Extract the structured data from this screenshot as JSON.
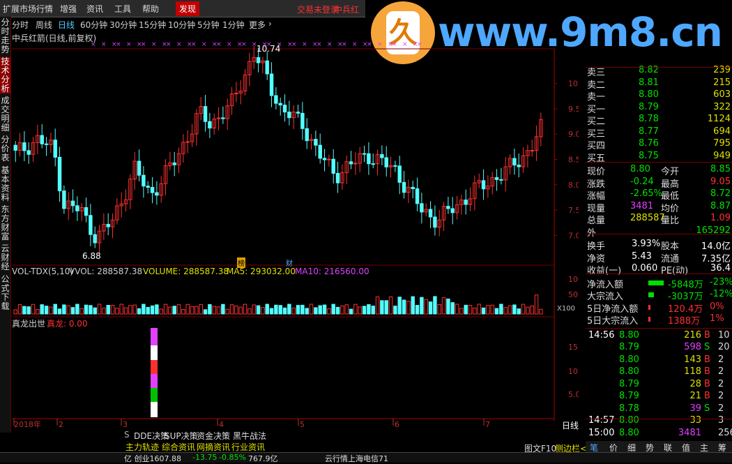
{
  "menu": {
    "items": [
      "扩展市场行情",
      "增强",
      "资讯",
      "工具",
      "帮助"
    ],
    "active": "发现",
    "alert1": "交易未登录",
    "alert2": "中兵红"
  },
  "left_tabs": [
    "分时走势",
    "技术分析",
    "成交明细",
    "分价表",
    "基本资料",
    "东方财富",
    "云财经",
    "公式下载"
  ],
  "periods": [
    "分时",
    "周线",
    "日线",
    "60分钟",
    "30分钟",
    "15分钟",
    "10分钟",
    "5分钟",
    "1分钟",
    "更多"
  ],
  "selected_period": "日线",
  "stock_title": "中兵红箭(日线,前复权)",
  "watermark": {
    "text": "www.9m8.cn",
    "logo_char": "久"
  },
  "price_axis": [
    "10.00",
    "9.50",
    "9.00",
    "8.50",
    "8.00",
    "7.50",
    "7.00"
  ],
  "high_label": "10.74",
  "low_label": "6.88",
  "badges": {
    "b1": "榜",
    "b2": "财"
  },
  "vol_panel": {
    "name": "VOL-TDX(5,10)",
    "vvol": "VVOL: 288587.38",
    "volume": "VOLUME: 288587.38",
    "ma5": "MA5: 293032.00",
    "ma10": "MA10: 216560.00",
    "axis": [
      "10000",
      "5000",
      "X100"
    ]
  },
  "ind_panel": {
    "name": "真龙出世",
    "value": "真龙: 0.00",
    "axis": [
      "15.00",
      "10.00",
      "5.00"
    ]
  },
  "dates": [
    "2018年",
    "2",
    "3",
    "4",
    "5",
    "6",
    "7"
  ],
  "period_label": "日线",
  "orderbook": [
    {
      "label": "卖三",
      "price": "8.82",
      "vol": "239",
      "color": "#00e000"
    },
    {
      "label": "卖二",
      "price": "8.81",
      "vol": "215",
      "color": "#00e000"
    },
    {
      "label": "卖一",
      "price": "8.80",
      "vol": "603",
      "color": "#00e000"
    },
    {
      "label": "买一",
      "price": "8.79",
      "vol": "322",
      "color": "#00e000"
    },
    {
      "label": "买二",
      "price": "8.78",
      "vol": "1124",
      "color": "#00e000"
    },
    {
      "label": "买三",
      "price": "8.77",
      "vol": "694",
      "color": "#00e000"
    },
    {
      "label": "买四",
      "price": "8.76",
      "vol": "795",
      "color": "#00e000"
    },
    {
      "label": "买五",
      "price": "8.75",
      "vol": "949",
      "color": "#00e000"
    }
  ],
  "quote": [
    {
      "l1": "现价",
      "v1": "8.80",
      "c1": "#00e000",
      "l2": "今开",
      "v2": "8.85",
      "c2": "#00e000"
    },
    {
      "l1": "涨跌",
      "v1": "-0.24",
      "c1": "#00e000",
      "l2": "最高",
      "v2": "9.05",
      "c2": "#ff3030"
    },
    {
      "l1": "涨幅",
      "v1": "-2.65%",
      "c1": "#00e000",
      "l2": "最低",
      "v2": "8.72",
      "c2": "#00e000"
    },
    {
      "l1": "现量",
      "v1": "3481",
      "c1": "#e040ff",
      "l2": "均价",
      "v2": "8.87",
      "c2": "#00e000"
    },
    {
      "l1": "总量",
      "v1": "288587",
      "c1": "#e0e000",
      "l2": "量比",
      "v2": "1.09",
      "c2": "#ff3030"
    },
    {
      "l1": "外",
      "v1": "",
      "c1": "#e0e000",
      "l2": "",
      "v2": "165292",
      "c2": "#00e000"
    }
  ],
  "fundamentals": [
    {
      "l1": "换手",
      "v1": "3.93%",
      "l2": "股本",
      "v2": "14.0亿"
    },
    {
      "l1": "净资",
      "v1": "5.43",
      "l2": "流通",
      "v2": "7.35亿"
    },
    {
      "l1": "收益(一)",
      "v1": "0.060",
      "l2": "PE(动)",
      "v2": "36.4"
    }
  ],
  "flows": [
    {
      "label": "净流入额",
      "value": "-5848万",
      "pct": "-23%",
      "color": "#00e000",
      "bar": 0.9,
      "barcolor": "#00e000"
    },
    {
      "label": "大宗流入",
      "value": "-3037万",
      "pct": "-12%",
      "color": "#00e000",
      "bar": 0.35,
      "barcolor": "#00e000"
    },
    {
      "label": "5日净流入额",
      "value": "120.4万",
      "pct": "0%",
      "color": "#ff3030",
      "bar": 0.1,
      "barcolor": "#ff3030"
    },
    {
      "label": "5日大宗流入",
      "value": "1388万",
      "pct": "1%",
      "color": "#ff3030",
      "bar": 0.1,
      "barcolor": "#ff3030"
    }
  ],
  "ticks": [
    {
      "time": "14:56",
      "price": "8.80",
      "vol": "216",
      "side": "B",
      "n": "10"
    },
    {
      "time": "",
      "price": "8.79",
      "vol": "598",
      "side": "S",
      "n": "20"
    },
    {
      "time": "",
      "price": "8.80",
      "vol": "143",
      "side": "B",
      "n": "2"
    },
    {
      "time": "",
      "price": "8.80",
      "vol": "118",
      "side": "B",
      "n": "2"
    },
    {
      "time": "",
      "price": "8.79",
      "vol": "28",
      "side": "B",
      "n": "2"
    },
    {
      "time": "",
      "price": "8.79",
      "vol": "21",
      "side": "B",
      "n": "2"
    },
    {
      "time": "",
      "price": "8.78",
      "vol": "39",
      "side": "S",
      "n": "2"
    },
    {
      "time": "14:57",
      "price": "8.80",
      "vol": "33",
      "side": "",
      "n": "3"
    },
    {
      "time": "15:00",
      "price": "8.80",
      "vol": "3481",
      "side": "",
      "n": "256"
    }
  ],
  "bottom_tabs": [
    "DDE决策",
    "SUP决策",
    "资金决策",
    "黑牛战法"
  ],
  "bottom_tabs2": [
    "主力轨迹",
    "综合资讯",
    "网摘资讯",
    "行业资讯"
  ],
  "right_icons": [
    "笔",
    "价",
    "细",
    "势",
    "联",
    "值",
    "主",
    "筹"
  ],
  "bottom_right": {
    "a": "图文F10",
    "b": "侧边栏<"
  },
  "status": {
    "index": "亿 创业1607.88",
    "chg": "-13.75",
    "pct": "-0.85%",
    "amt": "767.9亿",
    "msg": "云行情上海电信71"
  }
}
